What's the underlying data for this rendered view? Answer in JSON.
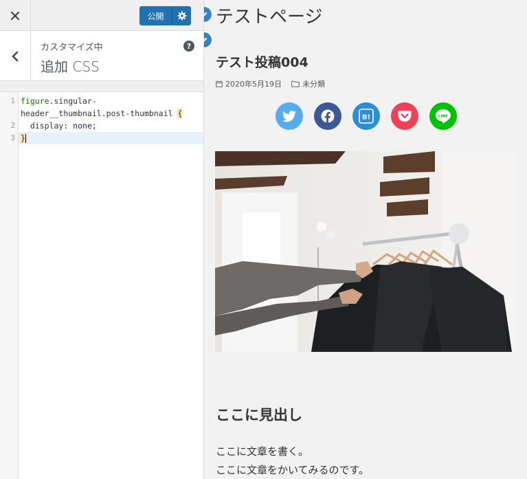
{
  "customizer": {
    "close_icon": "close-icon",
    "publish_label": "公開",
    "settings_icon": "gear-icon",
    "section_sub": "カスタマイズ中",
    "section_title": "追加 CSS",
    "help_icon_text": "?",
    "code": {
      "line_numbers": [
        "1",
        "2",
        "3"
      ],
      "line1_selector": "figure",
      "line1_rest": ".singular-",
      "line1b": "header__thumbnail.post-thumbnail ",
      "line1_brace": "{",
      "line2_prop": "  display: ",
      "line2_val": "none",
      "line2_end": ";",
      "line3_brace": "}"
    }
  },
  "preview": {
    "site_title": "テストページ",
    "post_title": "テスト投稿004",
    "date": "2020年5月19日",
    "category": "未分類",
    "share_buttons": [
      {
        "name": "twitter",
        "color": "#55acee",
        "label": ""
      },
      {
        "name": "facebook",
        "color": "#3b5998",
        "label": ""
      },
      {
        "name": "hatena",
        "color": "#2c8fd6",
        "label": "B!"
      },
      {
        "name": "pocket",
        "color": "#ef4056",
        "label": ""
      },
      {
        "name": "line",
        "color": "#00c300",
        "label": "LINE"
      }
    ],
    "heading": "ここに見出し",
    "paragraphs": [
      "ここに文章を書く。",
      "ここに文章をかいてみるのです。"
    ]
  },
  "colors": {
    "accent": "#2271b1",
    "shortcut": "#3582c4"
  }
}
